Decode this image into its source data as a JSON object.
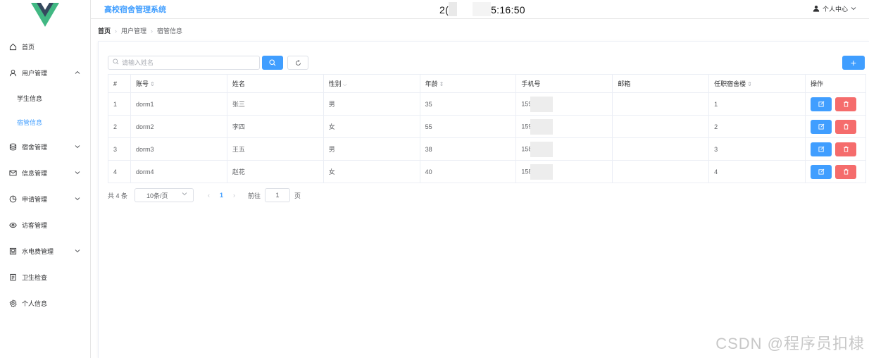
{
  "header": {
    "app_title": "高校宿舍管理系统",
    "clock_prefix": "2(",
    "clock_suffix": "5:16:50",
    "user_menu_label": "个人中心"
  },
  "sidebar": {
    "items": [
      {
        "label": "首页"
      },
      {
        "label": "用户管理",
        "children": [
          {
            "label": "学生信息"
          },
          {
            "label": "宿管信息"
          }
        ]
      },
      {
        "label": "宿舍管理"
      },
      {
        "label": "信息管理"
      },
      {
        "label": "申请管理"
      },
      {
        "label": "访客管理"
      },
      {
        "label": "水电费管理"
      },
      {
        "label": "卫生检查"
      },
      {
        "label": "个人信息"
      }
    ]
  },
  "breadcrumb": [
    "首页",
    "用户管理",
    "宿管信息"
  ],
  "search": {
    "placeholder": "请输入姓名",
    "value": ""
  },
  "table": {
    "columns": [
      "#",
      "账号",
      "姓名",
      "性别",
      "年龄",
      "手机号",
      "邮箱",
      "任职宿舍楼",
      "操作"
    ],
    "rows": [
      {
        "index": "1",
        "account": "dorm1",
        "name": "张三",
        "gender": "男",
        "age": "35",
        "phone": "159",
        "email": "",
        "building": "1"
      },
      {
        "index": "2",
        "account": "dorm2",
        "name": "李四",
        "gender": "女",
        "age": "55",
        "phone": "159",
        "email": "",
        "building": "2"
      },
      {
        "index": "3",
        "account": "dorm3",
        "name": "王五",
        "gender": "男",
        "age": "38",
        "phone": "158",
        "email": "",
        "building": "3"
      },
      {
        "index": "4",
        "account": "dorm4",
        "name": "赵花",
        "gender": "女",
        "age": "40",
        "phone": "158",
        "email": "",
        "building": "4"
      }
    ]
  },
  "pagination": {
    "total_label": "共 4 条",
    "page_size": "10条/页",
    "current_page": "1",
    "goto_label": "前往",
    "goto_value": "1",
    "page_unit": "页"
  },
  "watermark": "CSDN @程序员扣棣",
  "colors": {
    "primary": "#409eff",
    "danger": "#f56c6c",
    "logo_green": "#41b883",
    "logo_dark": "#35495e"
  }
}
